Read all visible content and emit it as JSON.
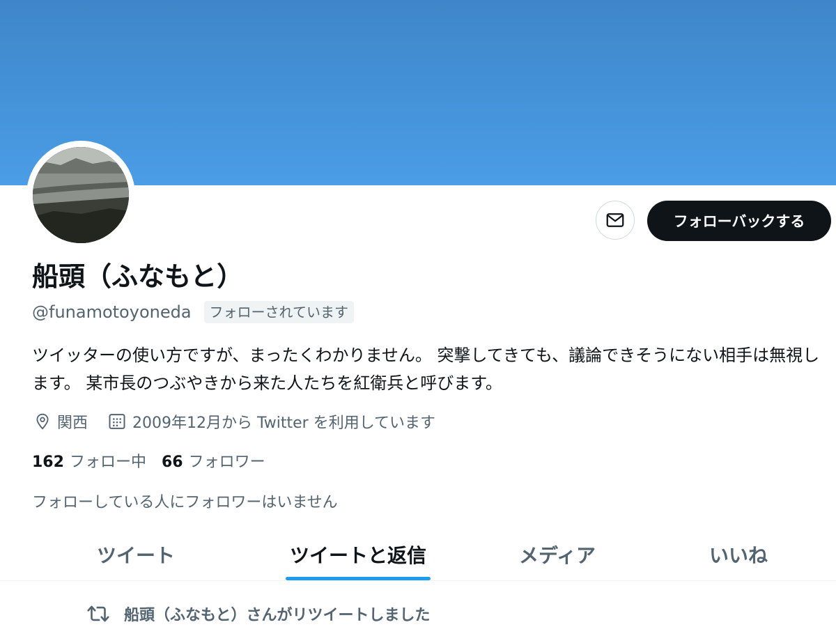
{
  "profile": {
    "display_name": "船頭（ふなもと）",
    "handle": "@funamotoyoneda",
    "follows_you_badge": "フォローされています",
    "bio": "ツイッターの使い方ですが、まったくわかりません。 突撃してきても、議論できそうにない相手は無視します。 某市長のつぶやきから来た人たちを紅衛兵と呼びます。",
    "location": "関西",
    "joined": "2009年12月から Twitter を利用しています",
    "following_count": "162",
    "following_label": "フォロー中",
    "followers_count": "66",
    "followers_label": "フォロワー",
    "mutual_followers_text": "フォローしている人にフォロワーはいません"
  },
  "actions": {
    "message_icon": "envelope-icon",
    "follow_back_label": "フォローバックする"
  },
  "tabs": [
    {
      "label": "ツイート",
      "active": false
    },
    {
      "label": "ツイートと返信",
      "active": true
    },
    {
      "label": "メディア",
      "active": false
    },
    {
      "label": "いいね",
      "active": false
    }
  ],
  "timeline": {
    "retweet_notice": "船頭（ふなもと）さんがリツイートしました",
    "retweet_icon": "retweet-icon"
  },
  "colors": {
    "banner": "#4a9de6",
    "accent": "#1d9bf0",
    "primary_text": "#0f1419",
    "secondary_text": "#536471",
    "button_dark": "#0f1419"
  }
}
